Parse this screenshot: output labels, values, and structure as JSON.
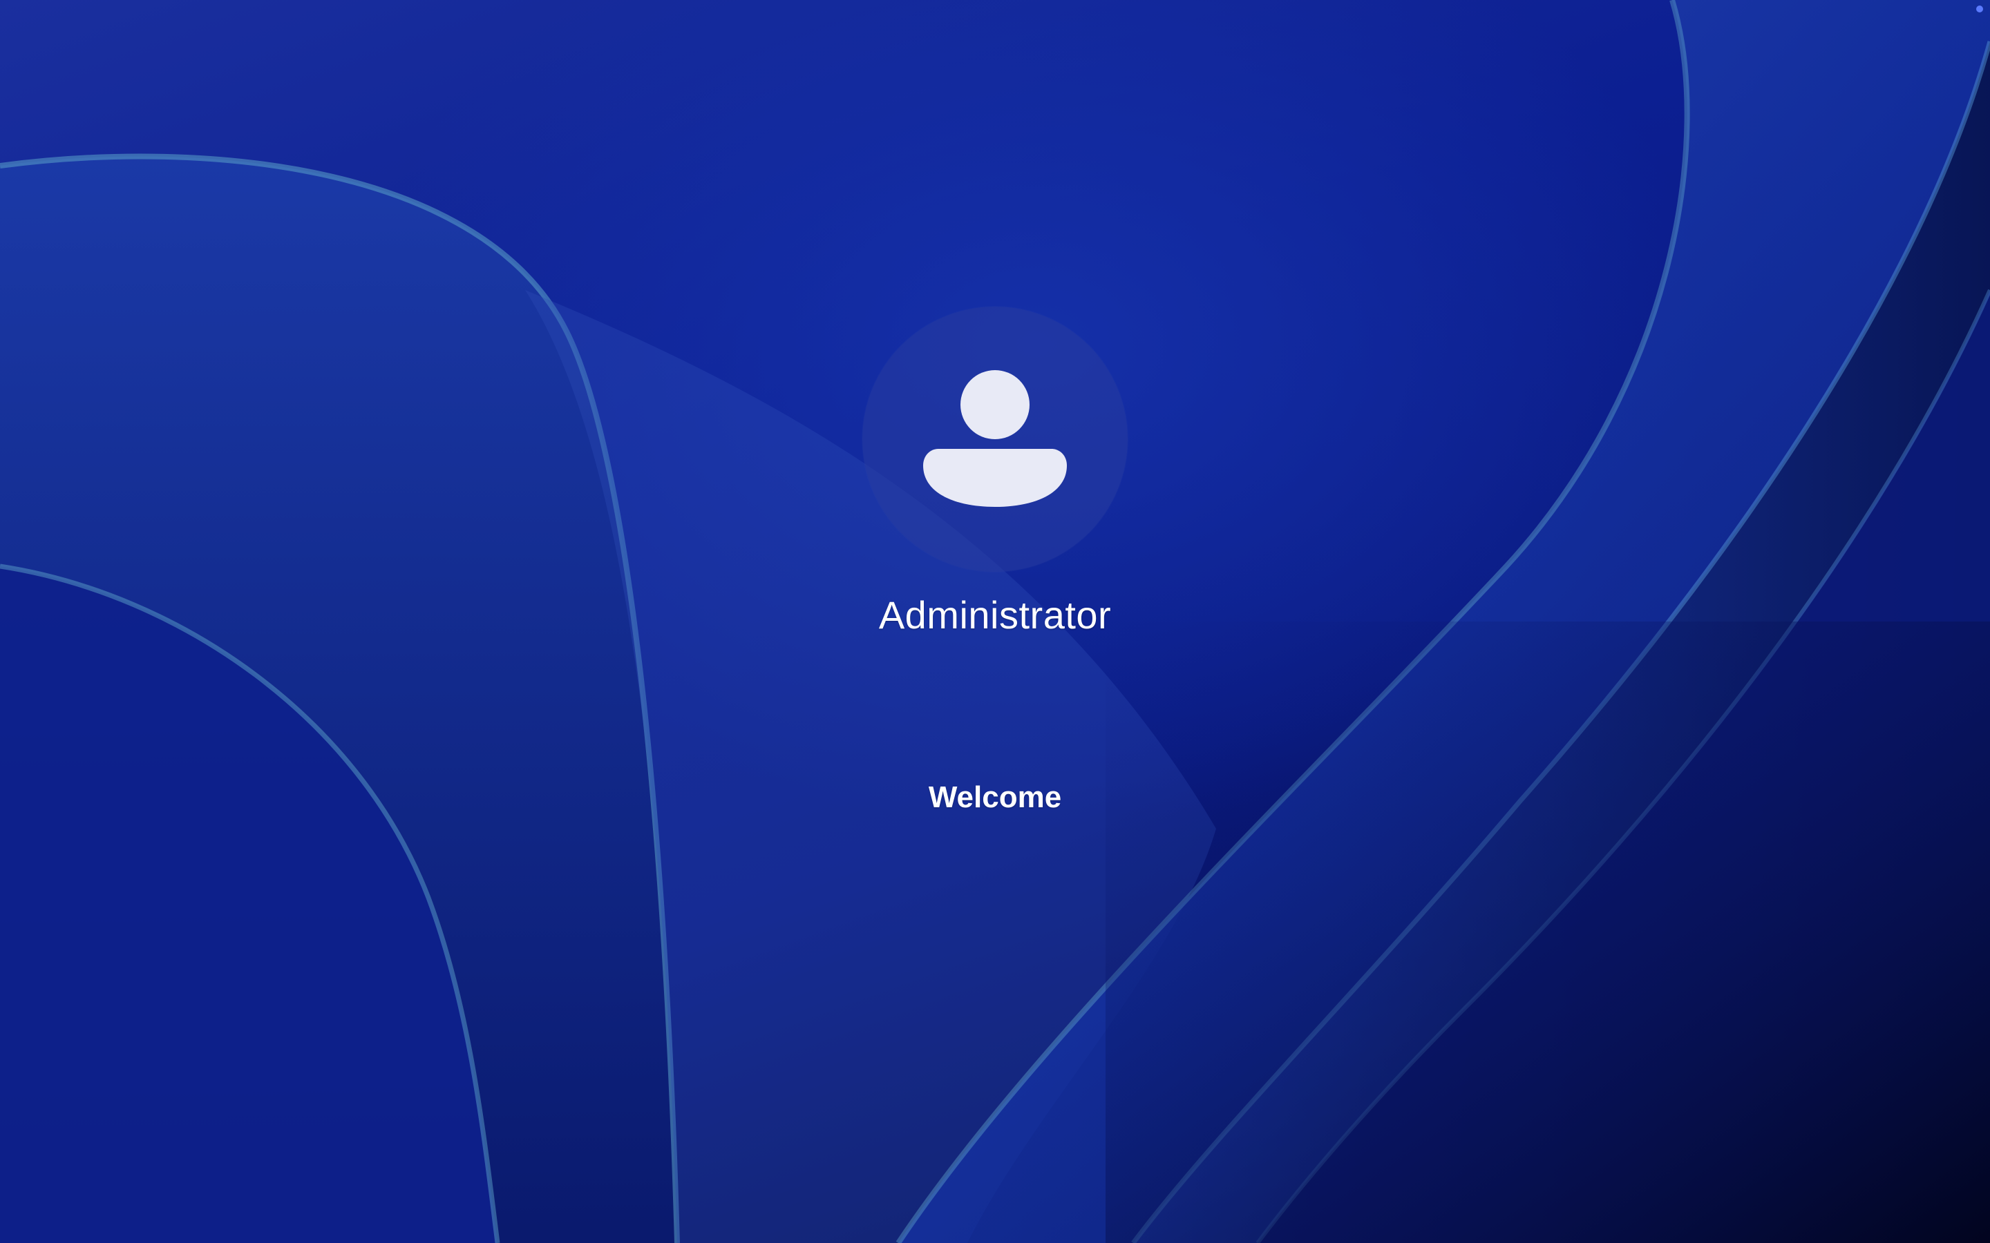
{
  "login": {
    "user_name": "Administrator",
    "status": "Welcome",
    "avatar_icon": "user-silhouette-icon"
  },
  "colors": {
    "background": "#0c1f92",
    "text": "#ffffff",
    "avatar_circle": "#28389e",
    "avatar_glyph": "#e8eaf6"
  }
}
